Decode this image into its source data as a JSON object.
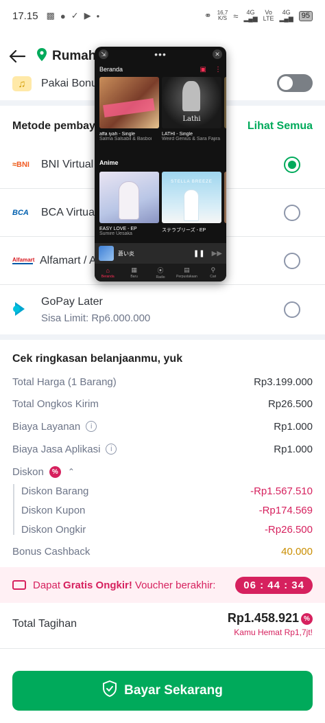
{
  "status_bar": {
    "time": "17.15",
    "net_speed_value": "16,7",
    "net_speed_unit": "K/S",
    "sig1": "4G",
    "sig2_top": "Vo",
    "sig2_mid": "4G",
    "sig2_bottom": "LTE",
    "battery": "95"
  },
  "header": {
    "title": "Rumah"
  },
  "bonus": {
    "label": "Pakai Bonus"
  },
  "payment": {
    "title": "Metode pembaya",
    "see_all": "Lihat Semua",
    "methods": [
      {
        "logo": "BNI",
        "name": "BNI Virtual A",
        "selected": true
      },
      {
        "logo": "BCA",
        "name": "BCA Virtual",
        "selected": false
      },
      {
        "logo": "Alfamart",
        "name": "Alfamart / A",
        "selected": false
      },
      {
        "logo": "GoPay",
        "name": "GoPay Later",
        "sub": "Sisa Limit: Rp6.000.000",
        "selected": false
      }
    ]
  },
  "summary": {
    "title": "Cek ringkasan belanjaanmu, yuk",
    "total_harga_label": "Total Harga (1 Barang)",
    "total_harga": "Rp3.199.000",
    "ongkir_label": "Total Ongkos Kirim",
    "ongkir": "Rp26.500",
    "layanan_label": "Biaya Layanan",
    "layanan": "Rp1.000",
    "aplikasi_label": "Biaya Jasa Aplikasi",
    "aplikasi": "Rp1.000",
    "diskon_label": "Diskon",
    "diskon_barang_label": "Diskon Barang",
    "diskon_barang": "-Rp1.567.510",
    "diskon_kupon_label": "Diskon Kupon",
    "diskon_kupon": "-Rp174.569",
    "diskon_ongkir_label": "Diskon Ongkir",
    "diskon_ongkir": "-Rp26.500",
    "cashback_label": "Bonus Cashback",
    "cashback": "40.000"
  },
  "voucher": {
    "prefix": "Dapat",
    "highlight": "Gratis Ongkir!",
    "suffix": "Voucher berakhir:",
    "timer": "06 : 44 : 34"
  },
  "total": {
    "label": "Total Tagihan",
    "value": "Rp1.458.921",
    "hemat": "Kamu Hemat Rp1,7jt!"
  },
  "pay_button": {
    "label": "Bayar Sekarang"
  },
  "music_overlay": {
    "header": "Beranda",
    "section": "Anime",
    "row1": [
      {
        "title": "affa iyah - Single",
        "artist": "Salma Salsabil & Basboi"
      },
      {
        "title": "LATHI - Single",
        "artist": "Weird Genius & Sara Fajira",
        "art_text": "Lathi"
      }
    ],
    "row2": [
      {
        "title": "EASY LOVE - EP",
        "artist": "Sumire Uesaka"
      },
      {
        "title": "ステラブリーズ - EP",
        "artist": "",
        "art_text": "STELLA BREEZE"
      }
    ],
    "now_playing": "蒼い炎",
    "tabs": [
      "Beranda",
      "Baru",
      "Radio",
      "Perpustakaan",
      "Cari"
    ],
    "colors": {
      "accent": "#ff2d55"
    }
  },
  "colors": {
    "green": "#00aa5b",
    "pink": "#d6215e",
    "cashback": "#c98d00"
  }
}
